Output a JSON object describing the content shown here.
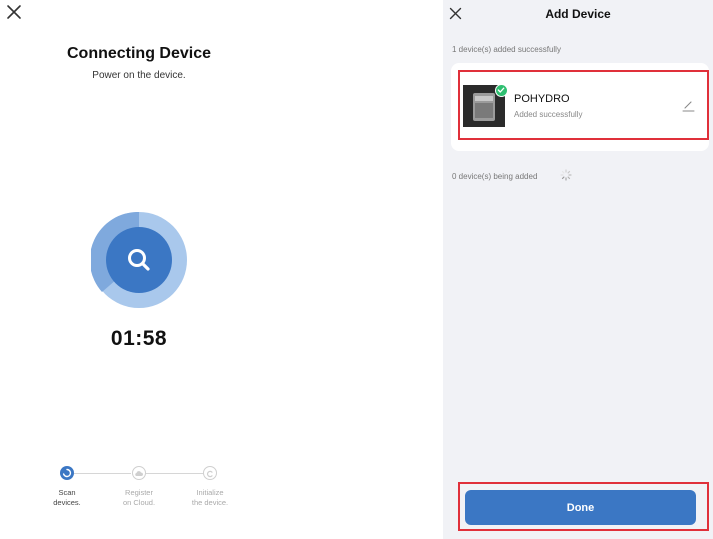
{
  "left": {
    "title": "Connecting Device",
    "subtitle": "Power on the device.",
    "timer": "01:58",
    "steps": [
      {
        "label": "Scan\ndevices.",
        "active": true
      },
      {
        "label": "Register\non Cloud.",
        "active": false
      },
      {
        "label": "Initialize\nthe device.",
        "active": false
      }
    ]
  },
  "right": {
    "title": "Add Device",
    "added_count": "1 device(s) added successfully",
    "device": {
      "name": "POHYDRO",
      "status": "Added successfully"
    },
    "adding_count": "0 device(s) being added",
    "done_label": "Done"
  },
  "colors": {
    "primary": "#3b77c4",
    "highlight": "#e0303a",
    "success": "#2fbf71"
  },
  "icons": [
    "close-icon",
    "search-icon",
    "check-icon",
    "edit-icon",
    "spinner-icon",
    "cloud-icon",
    "initialize-icon"
  ]
}
